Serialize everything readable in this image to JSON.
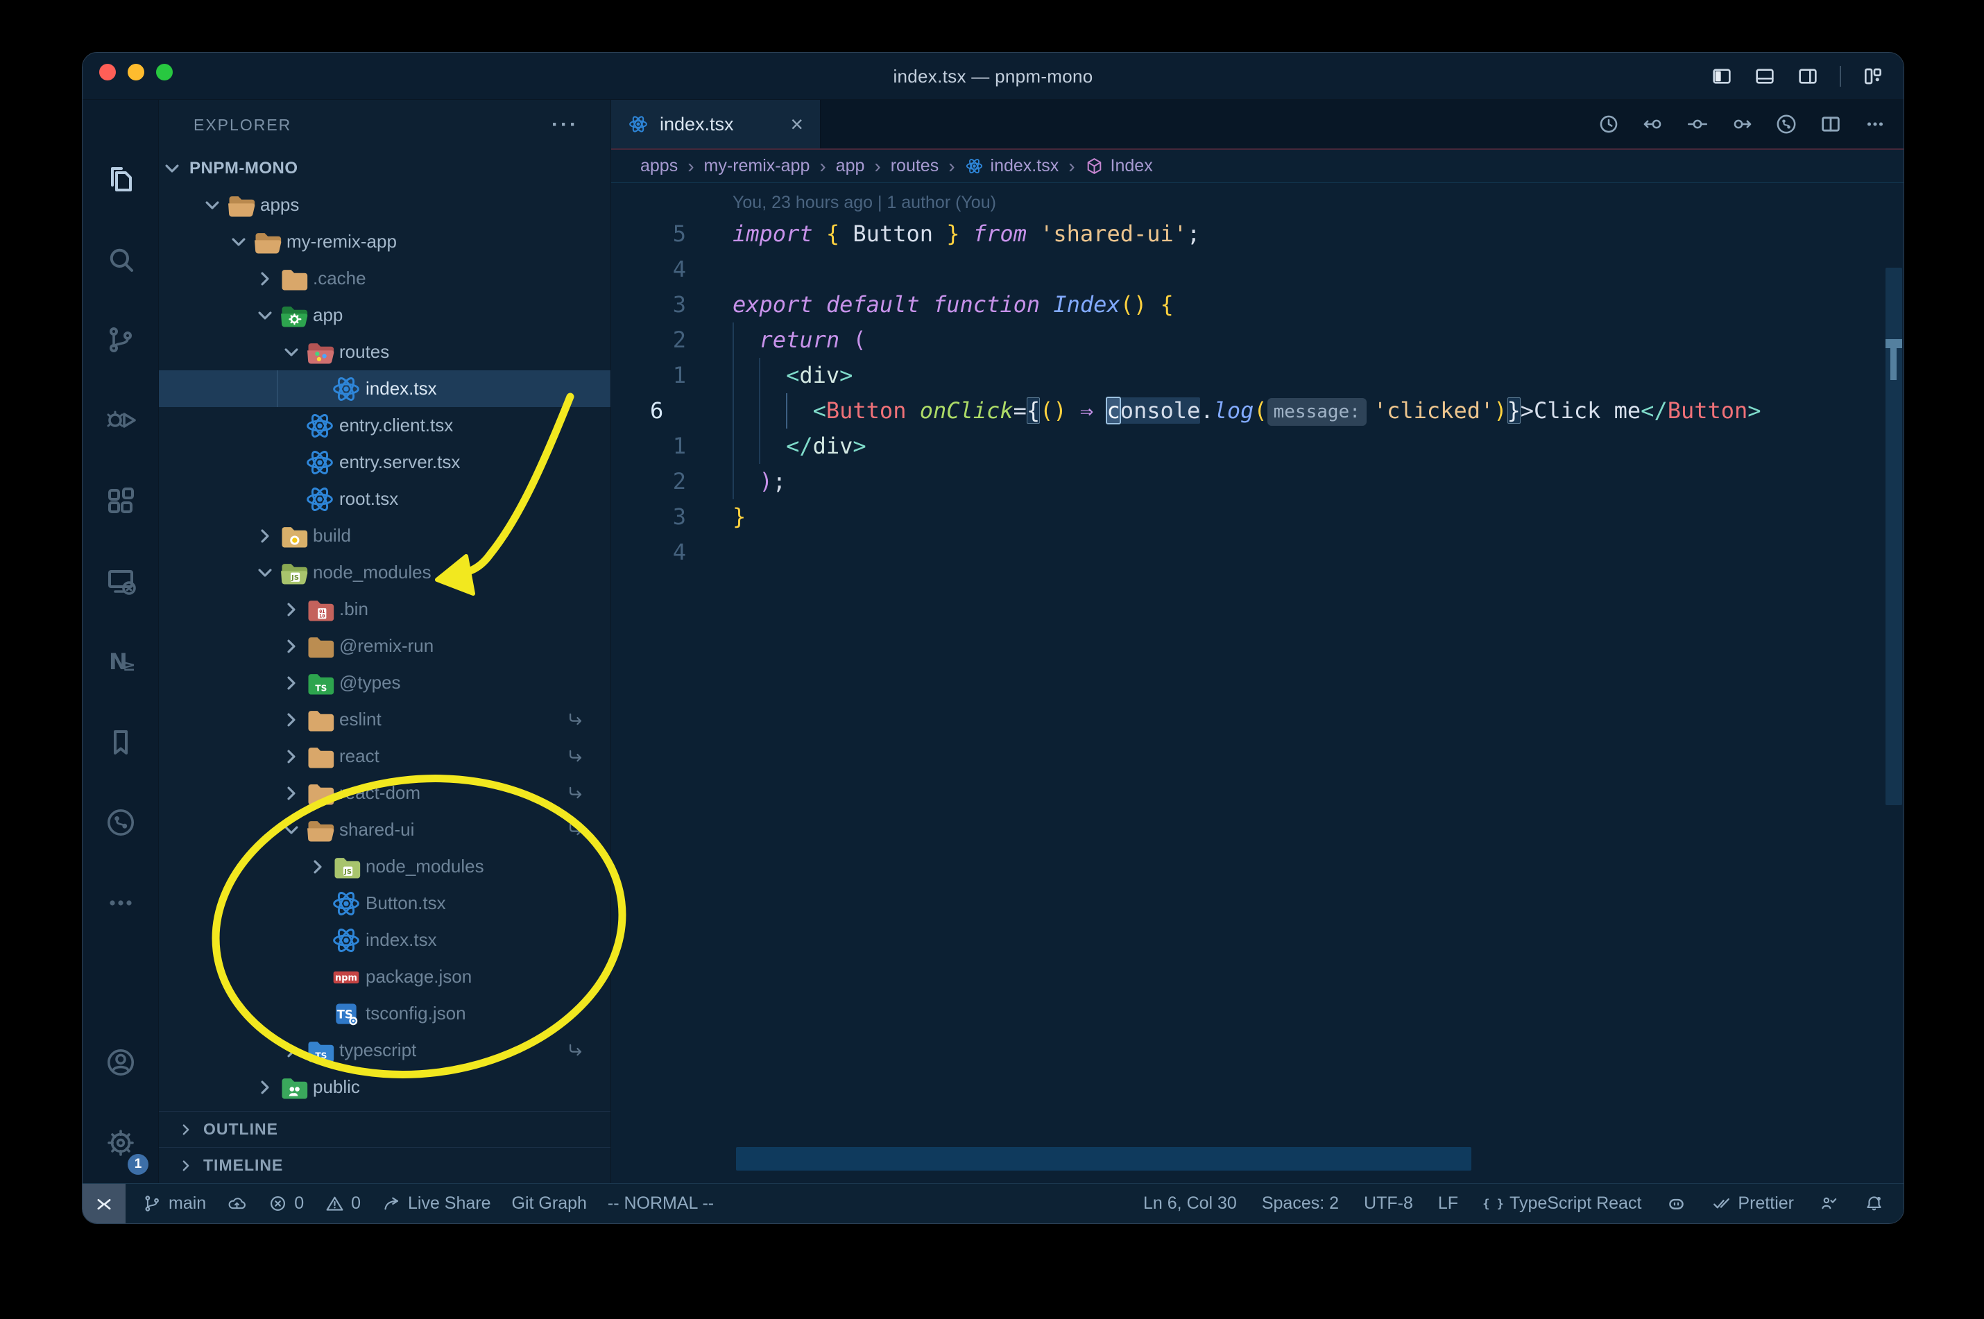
{
  "window": {
    "title": "index.tsx — pnpm-mono"
  },
  "titlebar": {
    "icons": [
      "panel-left",
      "panel-bottom",
      "panel-right",
      "sep",
      "layout"
    ]
  },
  "activity_bar": {
    "top": [
      {
        "name": "explorer",
        "icon": "files",
        "active": true
      },
      {
        "name": "search",
        "icon": "search"
      },
      {
        "name": "source-control",
        "icon": "scm"
      },
      {
        "name": "run-debug",
        "icon": "debug"
      },
      {
        "name": "extensions",
        "icon": "extensions"
      },
      {
        "name": "remote-explorer",
        "icon": "remote-explorer"
      },
      {
        "name": "neovim",
        "icon": "neovim"
      },
      {
        "name": "bookmarks",
        "icon": "bookmark"
      },
      {
        "name": "git-graph",
        "icon": "git-graph"
      },
      {
        "name": "more-views",
        "icon": "more"
      }
    ],
    "bottom": [
      {
        "name": "accounts",
        "icon": "account"
      },
      {
        "name": "settings",
        "icon": "settings",
        "badge": "1"
      }
    ]
  },
  "sidebar": {
    "header": "EXPLORER",
    "header_more": "···",
    "section": "PNPM-MONO",
    "tree": [
      {
        "label": "apps",
        "icon": "tan",
        "lvl": 1,
        "chev": "o"
      },
      {
        "label": "my-remix-app",
        "icon": "tan",
        "lvl": 2,
        "chev": "o"
      },
      {
        "label": ".cache",
        "icon": "tan",
        "lvl": 3,
        "chev": "c",
        "dim": true
      },
      {
        "label": "app",
        "icon": "app",
        "lvl": 3,
        "chev": "o"
      },
      {
        "label": "routes",
        "icon": "routes",
        "lvl": 4,
        "chev": "o"
      },
      {
        "label": "index.tsx",
        "icon": "react",
        "lvl": 5,
        "chev": "n",
        "sel": true
      },
      {
        "label": "entry.client.tsx",
        "icon": "react",
        "lvl": 4,
        "chev": "n"
      },
      {
        "label": "entry.server.tsx",
        "icon": "react",
        "lvl": 4,
        "chev": "n"
      },
      {
        "label": "root.tsx",
        "icon": "react",
        "lvl": 4,
        "chev": "n"
      },
      {
        "label": "build",
        "icon": "build",
        "lvl": 3,
        "chev": "c",
        "dim": true
      },
      {
        "label": "node_modules",
        "icon": "nm",
        "lvl": 3,
        "chev": "o",
        "dim": true
      },
      {
        "label": ".bin",
        "icon": "bin",
        "lvl": 4,
        "chev": "c",
        "dim": true
      },
      {
        "label": "@remix-run",
        "icon": "remix",
        "lvl": 4,
        "chev": "c",
        "dim": true
      },
      {
        "label": "@types",
        "icon": "types",
        "lvl": 4,
        "chev": "c",
        "dim": true
      },
      {
        "label": "eslint",
        "icon": "tan",
        "lvl": 4,
        "chev": "c",
        "dim": true,
        "link": true
      },
      {
        "label": "react",
        "icon": "tan",
        "lvl": 4,
        "chev": "c",
        "dim": true,
        "link": true
      },
      {
        "label": "react-dom",
        "icon": "tan",
        "lvl": 4,
        "chev": "c",
        "dim": true,
        "link": true
      },
      {
        "label": "shared-ui",
        "icon": "tan",
        "lvl": 4,
        "chev": "o",
        "dim": true,
        "link": true
      },
      {
        "label": "node_modules",
        "icon": "nm",
        "lvl": 5,
        "chev": "c",
        "dim": true
      },
      {
        "label": "Button.tsx",
        "icon": "react",
        "lvl": 5,
        "chev": "n",
        "dim": true
      },
      {
        "label": "index.tsx",
        "icon": "react",
        "lvl": 5,
        "chev": "n",
        "dim": true
      },
      {
        "label": "package.json",
        "icon": "npm",
        "lvl": 5,
        "chev": "n",
        "dim": true
      },
      {
        "label": "tsconfig.json",
        "icon": "tsgear",
        "lvl": 5,
        "chev": "n",
        "dim": true
      },
      {
        "label": "typescript",
        "icon": "tsf",
        "lvl": 4,
        "chev": "c",
        "dim": true,
        "link": true
      },
      {
        "label": "public",
        "icon": "pub",
        "lvl": 3,
        "chev": "c"
      }
    ],
    "panels": [
      "OUTLINE",
      "TIMELINE"
    ]
  },
  "editor": {
    "tab": {
      "label": "index.tsx",
      "close": "×"
    },
    "actions": [
      "history",
      "prev-change",
      "change",
      "next-change",
      "file-history",
      "split",
      "more"
    ],
    "breadcrumbs": [
      {
        "label": "apps"
      },
      {
        "label": "my-remix-app"
      },
      {
        "label": "app"
      },
      {
        "label": "routes"
      },
      {
        "label": "index.tsx",
        "icon": "react"
      },
      {
        "label": "Index",
        "icon": "cube"
      }
    ],
    "blame": "You, 23 hours ago | 1 author (You)",
    "lines": [
      {
        "n": "5",
        "s": [
          [
            "import",
            "k"
          ],
          [
            " ",
            "t"
          ],
          [
            "{",
            "y"
          ],
          [
            " Button ",
            "t"
          ],
          [
            "}",
            "y"
          ],
          [
            " ",
            "t"
          ],
          [
            "from",
            "k"
          ],
          [
            " ",
            "t"
          ],
          [
            "'shared-ui'",
            "s"
          ],
          [
            ";",
            "t"
          ]
        ]
      },
      {
        "n": "4",
        "s": []
      },
      {
        "n": "3",
        "s": [
          [
            "export",
            "k"
          ],
          [
            " ",
            "t"
          ],
          [
            "default",
            "k"
          ],
          [
            " ",
            "t"
          ],
          [
            "function",
            "k"
          ],
          [
            " ",
            "t"
          ],
          [
            "Index",
            "f"
          ],
          [
            "()",
            "y"
          ],
          [
            " ",
            "t"
          ],
          [
            "{",
            "y"
          ]
        ]
      },
      {
        "n": "2",
        "s": [
          [
            "  ",
            "t"
          ],
          [
            "return",
            "k"
          ],
          [
            " ",
            "t"
          ],
          [
            "(",
            "p"
          ]
        ]
      },
      {
        "n": "1",
        "s": [
          [
            "    ",
            "t"
          ],
          [
            "<",
            "g"
          ],
          [
            "div",
            "n"
          ],
          [
            ">",
            "g"
          ]
        ]
      },
      {
        "n": "6",
        "cur": true,
        "s": [
          [
            "      ",
            "t"
          ],
          [
            "<",
            "g"
          ],
          [
            "Button",
            "c"
          ],
          [
            " ",
            "t"
          ],
          [
            "onClick",
            "a"
          ],
          [
            "=",
            "t"
          ],
          [
            "{",
            "b"
          ],
          [
            "()",
            "y"
          ],
          [
            " ",
            "t"
          ],
          [
            "⇒",
            "k"
          ],
          [
            " ",
            "t"
          ],
          [
            "c",
            "u"
          ],
          [
            "onsole",
            "w"
          ],
          [
            ".",
            "t"
          ],
          [
            "log",
            "f"
          ],
          [
            "(",
            "y"
          ],
          [
            "message:",
            "i"
          ],
          [
            "'clicked'",
            "s"
          ],
          [
            ")",
            "y"
          ],
          [
            "}",
            "b"
          ],
          [
            ">",
            "t"
          ],
          [
            "Click me",
            "t"
          ],
          [
            "</",
            "g"
          ],
          [
            "Button",
            "c"
          ],
          [
            ">",
            "g"
          ]
        ]
      },
      {
        "n": "1",
        "s": [
          [
            "    ",
            "t"
          ],
          [
            "</",
            "g"
          ],
          [
            "div",
            "n"
          ],
          [
            ">",
            "g"
          ]
        ]
      },
      {
        "n": "2",
        "s": [
          [
            "  ",
            "t"
          ],
          [
            ")",
            "p"
          ],
          [
            ";",
            "t"
          ]
        ]
      },
      {
        "n": "3",
        "s": [
          [
            "}",
            "y"
          ]
        ]
      },
      {
        "n": "4",
        "s": []
      }
    ]
  },
  "status_bar": {
    "left": [
      {
        "icons": [
          "branch"
        ],
        "label": "main",
        "name": "git-branch"
      },
      {
        "icons": [
          "sync"
        ],
        "label": "",
        "name": "sync-changes"
      },
      {
        "icons": [
          "error"
        ],
        "label": "0",
        "name": "problems-errors"
      },
      {
        "icons": [
          "warning"
        ],
        "label": "0",
        "name": "problems-warnings"
      },
      {
        "icons": [
          "share"
        ],
        "label": "Live Share",
        "name": "live-share"
      },
      {
        "icons": [],
        "label": "Git Graph",
        "name": "git-graph"
      },
      {
        "icons": [],
        "label": "-- NORMAL --",
        "name": "vim-mode"
      }
    ],
    "right": [
      {
        "icons": [],
        "label": "Ln 6, Col 30",
        "name": "cursor-position"
      },
      {
        "icons": [],
        "label": "Spaces: 2",
        "name": "indentation"
      },
      {
        "icons": [],
        "label": "UTF-8",
        "name": "encoding"
      },
      {
        "icons": [],
        "label": "LF",
        "name": "eol"
      },
      {
        "icons": [
          "braces"
        ],
        "label": "TypeScript React",
        "name": "language-mode"
      },
      {
        "icons": [
          "copilot"
        ],
        "label": "",
        "name": "copilot"
      },
      {
        "icons": [
          "dblcheck"
        ],
        "label": "Prettier",
        "name": "formatter"
      },
      {
        "icons": [
          "feedback"
        ],
        "label": "",
        "name": "feedback"
      },
      {
        "icons": [
          "bell-dot"
        ],
        "label": "",
        "name": "notifications"
      }
    ]
  },
  "annotations": {
    "color": "#f2e81f"
  }
}
